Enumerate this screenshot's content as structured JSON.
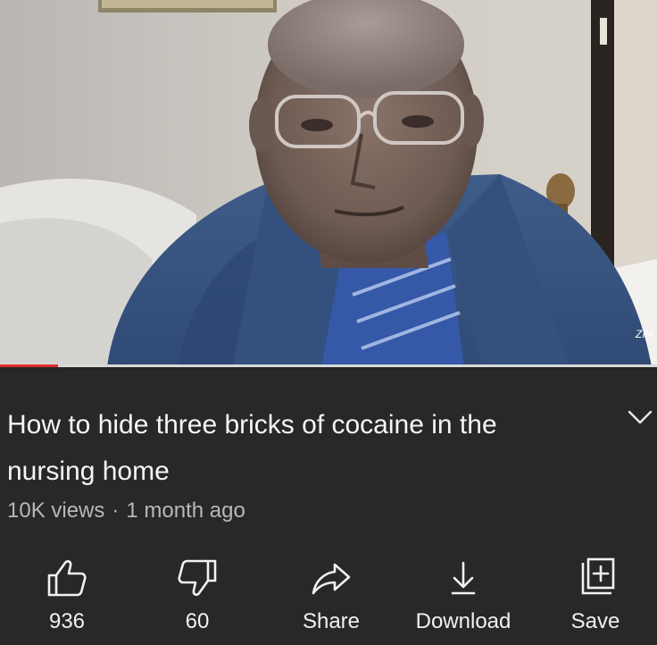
{
  "video": {
    "progress_fraction": 0.088,
    "progress_color": "#e02a2a",
    "thumbnail_subject": "elderly man in blue jacket and glasses"
  },
  "info": {
    "title": "How to hide three bricks of cocaine in the nursing home",
    "views": "10K views",
    "separator": "·",
    "age": "1 month ago"
  },
  "actions": [
    {
      "icon": "thumbs-up-icon",
      "label": "936"
    },
    {
      "icon": "thumbs-down-icon",
      "label": "60"
    },
    {
      "icon": "share-icon",
      "label": "Share"
    },
    {
      "icon": "download-icon",
      "label": "Download"
    },
    {
      "icon": "save-playlist-icon",
      "label": "Save"
    }
  ],
  "colors": {
    "background": "#282828",
    "text": "#f1f1f1",
    "meta_text": "#b8b8b8"
  }
}
